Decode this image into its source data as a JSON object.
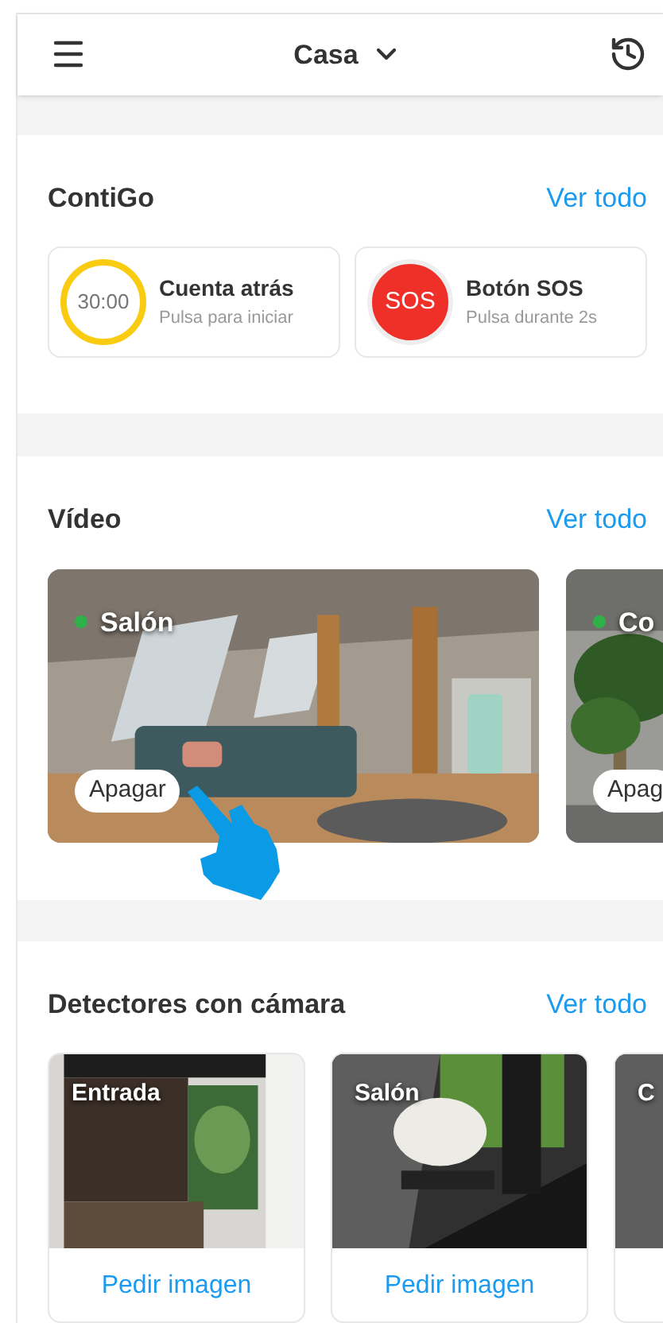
{
  "header": {
    "title": "Casa"
  },
  "contigo": {
    "title": "ContiGo",
    "link": "Ver todo",
    "items": [
      {
        "kind": "timer",
        "badge": "30:00",
        "title": "Cuenta atrás",
        "subtitle": "Pulsa para iniciar"
      },
      {
        "kind": "sos",
        "badge": "SOS",
        "title": "Botón SOS",
        "subtitle": "Pulsa durante 2s"
      }
    ]
  },
  "video": {
    "title": "Vídeo",
    "link": "Ver todo",
    "cameras": [
      {
        "name": "Salón",
        "online": true,
        "button": "Apagar"
      },
      {
        "name": "Co",
        "online": true,
        "button": "Apag"
      }
    ]
  },
  "detectors": {
    "title": "Detectores con cámara",
    "link": "Ver todo",
    "cameras": [
      {
        "name": "Entrada",
        "action": "Pedir imagen"
      },
      {
        "name": "Salón",
        "action": "Pedir imagen"
      },
      {
        "name": "C"
      }
    ]
  }
}
